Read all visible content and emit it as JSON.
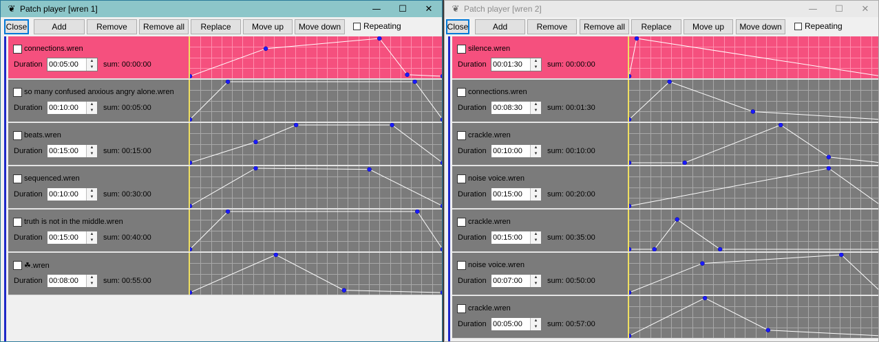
{
  "windows": [
    {
      "title": "Patch player [wren 1]",
      "app_icon": "wren-bird-icon",
      "controls": [
        "minimize",
        "maximize",
        "close"
      ],
      "toolbar": {
        "close": "Close",
        "add": "Add",
        "remove": "Remove",
        "remove_all": "Remove all",
        "replace": "Replace",
        "move_up": "Move up",
        "move_down": "Move down",
        "repeating": "Repeating"
      },
      "duration_label": "Duration",
      "rows": [
        {
          "name": "connections.wren",
          "duration": "00:05:00",
          "sum": "sum: 00:00:00",
          "active": true,
          "envelope": [
            [
              0,
              0
            ],
            [
              0.3,
              0.73
            ],
            [
              0.75,
              1
            ],
            [
              0.86,
              0.04
            ],
            [
              1,
              0
            ]
          ]
        },
        {
          "name": "so many confused anxious angry alone.wren",
          "duration": "00:10:00",
          "sum": "sum: 00:05:00",
          "active": false,
          "envelope": [
            [
              0,
              0
            ],
            [
              0.15,
              1
            ],
            [
              0.89,
              1
            ],
            [
              1,
              0
            ]
          ]
        },
        {
          "name": "beats.wren",
          "duration": "00:15:00",
          "sum": "sum: 00:15:00",
          "active": false,
          "envelope": [
            [
              0,
              0
            ],
            [
              0.26,
              0.55
            ],
            [
              0.42,
              1
            ],
            [
              0.8,
              1
            ],
            [
              1,
              0
            ]
          ]
        },
        {
          "name": "sequenced.wren",
          "duration": "00:10:00",
          "sum": "sum: 00:30:00",
          "active": false,
          "envelope": [
            [
              0,
              0
            ],
            [
              0.26,
              1
            ],
            [
              0.71,
              0.97
            ],
            [
              1,
              0
            ]
          ]
        },
        {
          "name": "truth is not in the middle.wren",
          "duration": "00:15:00",
          "sum": "sum: 00:40:00",
          "active": false,
          "envelope": [
            [
              0,
              0
            ],
            [
              0.15,
              1
            ],
            [
              0.9,
              1
            ],
            [
              1,
              0
            ]
          ]
        },
        {
          "name": "☘.wren",
          "duration": "00:08:00",
          "sum": "sum: 00:55:00",
          "active": false,
          "envelope": [
            [
              0,
              0
            ],
            [
              0.34,
              1
            ],
            [
              0.61,
              0.06
            ],
            [
              1,
              0
            ]
          ]
        }
      ]
    },
    {
      "title": "Patch player [wren 2]",
      "app_icon": "wren-bird-icon",
      "controls": [
        "minimize",
        "maximize",
        "close"
      ],
      "toolbar": {
        "close": "Close",
        "add": "Add",
        "remove": "Remove",
        "remove_all": "Remove all",
        "replace": "Replace",
        "move_up": "Move up",
        "move_down": "Move down",
        "repeating": "Repeating"
      },
      "duration_label": "Duration",
      "rows": [
        {
          "name": "silence.wren",
          "duration": "00:01:30",
          "sum": "sum: 00:00:00",
          "active": true,
          "envelope": [
            [
              0,
              0
            ],
            [
              0.03,
              1
            ],
            [
              1,
              0
            ]
          ]
        },
        {
          "name": "connections.wren",
          "duration": "00:08:30",
          "sum": "sum: 00:01:30",
          "active": false,
          "envelope": [
            [
              0,
              0
            ],
            [
              0.16,
              1
            ],
            [
              0.49,
              0.21
            ],
            [
              1,
              0
            ]
          ]
        },
        {
          "name": "crackle.wren",
          "duration": "00:10:00",
          "sum": "sum: 00:10:00",
          "active": false,
          "envelope": [
            [
              0,
              0
            ],
            [
              0.22,
              0
            ],
            [
              0.6,
              1
            ],
            [
              0.79,
              0.15
            ],
            [
              1,
              0
            ]
          ]
        },
        {
          "name": "noise voice.wren",
          "duration": "00:15:00",
          "sum": "sum: 00:20:00",
          "active": false,
          "envelope": [
            [
              0,
              0
            ],
            [
              0.79,
              1
            ],
            [
              1,
              0
            ]
          ]
        },
        {
          "name": "crackle.wren",
          "duration": "00:15:00",
          "sum": "sum: 00:35:00",
          "active": false,
          "envelope": [
            [
              0,
              0
            ],
            [
              0.1,
              0
            ],
            [
              0.19,
              0.79
            ],
            [
              0.36,
              0
            ],
            [
              1,
              0
            ]
          ]
        },
        {
          "name": "noise voice.wren",
          "duration": "00:07:00",
          "sum": "sum: 00:50:00",
          "active": false,
          "envelope": [
            [
              0,
              0
            ],
            [
              0.29,
              0.77
            ],
            [
              0.84,
              1
            ],
            [
              1,
              0
            ]
          ]
        },
        {
          "name": "crackle.wren",
          "duration": "00:05:00",
          "sum": "sum: 00:57:00",
          "active": false,
          "envelope": [
            [
              0,
              0
            ],
            [
              0.3,
              1
            ],
            [
              0.55,
              0.15
            ],
            [
              1,
              0
            ]
          ]
        }
      ]
    }
  ]
}
